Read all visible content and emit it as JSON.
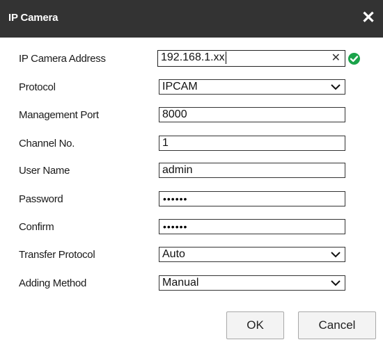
{
  "dialog": {
    "title": "IP Camera",
    "close_icon": "close-icon"
  },
  "form": {
    "ip_camera_address": {
      "label": "IP Camera Address",
      "value": "192.168.1.xx",
      "valid": true
    },
    "protocol": {
      "label": "Protocol",
      "value": "IPCAM"
    },
    "management_port": {
      "label": "Management Port",
      "value": "8000"
    },
    "channel_no": {
      "label": "Channel No.",
      "value": "1"
    },
    "user_name": {
      "label": "User Name",
      "value": "admin"
    },
    "password": {
      "label": "Password",
      "value": "••••••"
    },
    "confirm": {
      "label": "Confirm",
      "value": "••••••"
    },
    "transfer_protocol": {
      "label": "Transfer Protocol",
      "value": "Auto"
    },
    "adding_method": {
      "label": "Adding Method",
      "value": "Manual"
    }
  },
  "buttons": {
    "ok_label": "OK",
    "cancel_label": "Cancel"
  },
  "colors": {
    "titlebar": "#333333",
    "valid_check": "#1aa34a"
  }
}
